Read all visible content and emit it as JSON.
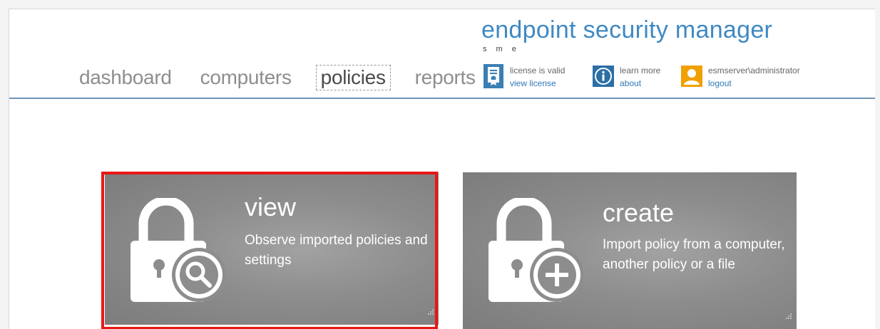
{
  "app": {
    "title": "endpoint security manager",
    "subtitle": "s m e"
  },
  "nav": {
    "items": [
      {
        "label": "dashboard",
        "active": false
      },
      {
        "label": "computers",
        "active": false
      },
      {
        "label": "policies",
        "active": true
      },
      {
        "label": "reports",
        "active": false
      }
    ]
  },
  "status": {
    "license": {
      "line1": "license is valid",
      "link": "view license",
      "icon": "license-icon"
    },
    "about": {
      "line1": "learn more",
      "link": "about",
      "icon": "info-icon"
    },
    "user": {
      "line1": "esmserver\\administrator",
      "link": "logout",
      "icon": "user-icon"
    }
  },
  "tiles": {
    "view": {
      "title": "view",
      "description": "Observe imported policies and settings",
      "icon": "lock-search-icon",
      "selected": true
    },
    "create": {
      "title": "create",
      "description": "Import policy from a computer, another policy or a file",
      "icon": "lock-add-icon",
      "selected": false
    }
  },
  "colors": {
    "accent": "#3f89c3",
    "header_line": "#6e95b8",
    "tile_bg": "#8d8d8d",
    "selection": "#e81717",
    "user_icon": "#f0a000"
  }
}
